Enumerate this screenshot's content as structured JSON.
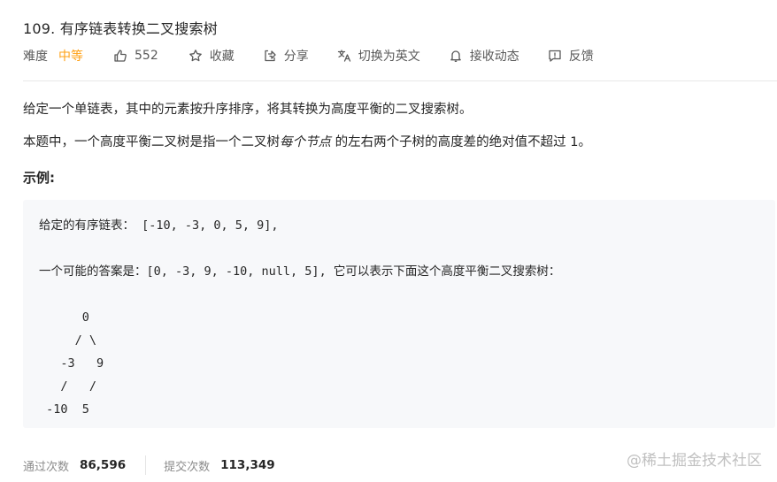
{
  "problem": {
    "title": "109. 有序链表转换二叉搜索树"
  },
  "meta": {
    "difficulty_label": "难度",
    "difficulty_value": "中等",
    "likes": "552",
    "favorite": "收藏",
    "share": "分享",
    "translate": "切换为英文",
    "notify": "接收动态",
    "feedback": "反馈"
  },
  "description": {
    "line1": "给定一个单链表，其中的元素按升序排序，将其转换为高度平衡的二叉搜索树。",
    "line2_before": "本题中，一个高度平衡二叉树是指一个二叉树",
    "line2_em": "每个节点",
    "line2_after": " 的左右两个子树的高度差的绝对值不超过 1。"
  },
  "example": {
    "heading": "示例:",
    "code": "给定的有序链表： [-10, -3, 0, 5, 9],\n\n一个可能的答案是：[0, -3, 9, -10, null, 5], 它可以表示下面这个高度平衡二叉搜索树：\n\n      0\n     / \\\n   -3   9\n   /   /\n -10  5"
  },
  "stats": {
    "accepted_label": "通过次数",
    "accepted_value": "86,596",
    "submissions_label": "提交次数",
    "submissions_value": "113,349"
  },
  "watermark": "@稀土掘金技术社区",
  "colors": {
    "difficulty_medium": "#ffa116",
    "code_bg": "#f7f8fa"
  }
}
